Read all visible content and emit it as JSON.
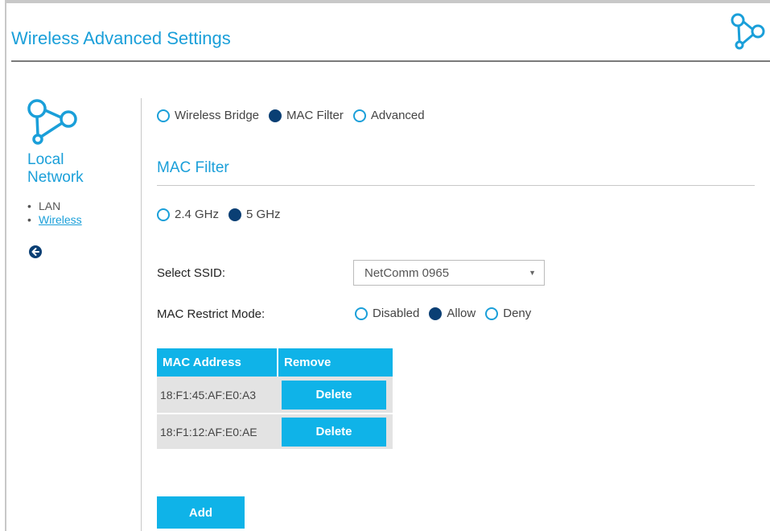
{
  "header": {
    "title": "Wireless Advanced Settings",
    "logo_icon": "network-nodes-icon"
  },
  "sidebar": {
    "title_line1": "Local",
    "title_line2": "Network",
    "logo_icon": "network-nodes-icon",
    "items": [
      {
        "label": "LAN",
        "active": false
      },
      {
        "label": "Wireless",
        "active": true
      }
    ],
    "back_icon": "arrow-left-circle-icon"
  },
  "tabs": {
    "options": [
      {
        "label": "Wireless Bridge",
        "selected": false
      },
      {
        "label": "MAC Filter",
        "selected": true
      },
      {
        "label": "Advanced",
        "selected": false
      }
    ]
  },
  "section": {
    "title": "MAC Filter"
  },
  "band": {
    "options": [
      {
        "label": "2.4 GHz",
        "selected": false
      },
      {
        "label": "5 GHz",
        "selected": true
      }
    ]
  },
  "ssid": {
    "label": "Select SSID:",
    "value": "NetComm 0965"
  },
  "restrict": {
    "label": "MAC Restrict Mode:",
    "options": [
      {
        "label": "Disabled",
        "selected": false
      },
      {
        "label": "Allow",
        "selected": true
      },
      {
        "label": "Deny",
        "selected": false
      }
    ]
  },
  "mac_table": {
    "headers": [
      "MAC Address",
      "Remove"
    ],
    "rows": [
      {
        "mac": "18:F1:45:AF:E0:A3",
        "action": "Delete"
      },
      {
        "mac": "18:F1:12:AF:E0:AE",
        "action": "Delete"
      }
    ]
  },
  "add_label": "Add",
  "colors": {
    "accent": "#1a9fd9",
    "button": "#0fb3e8",
    "radio_selected": "#0a3f74"
  }
}
